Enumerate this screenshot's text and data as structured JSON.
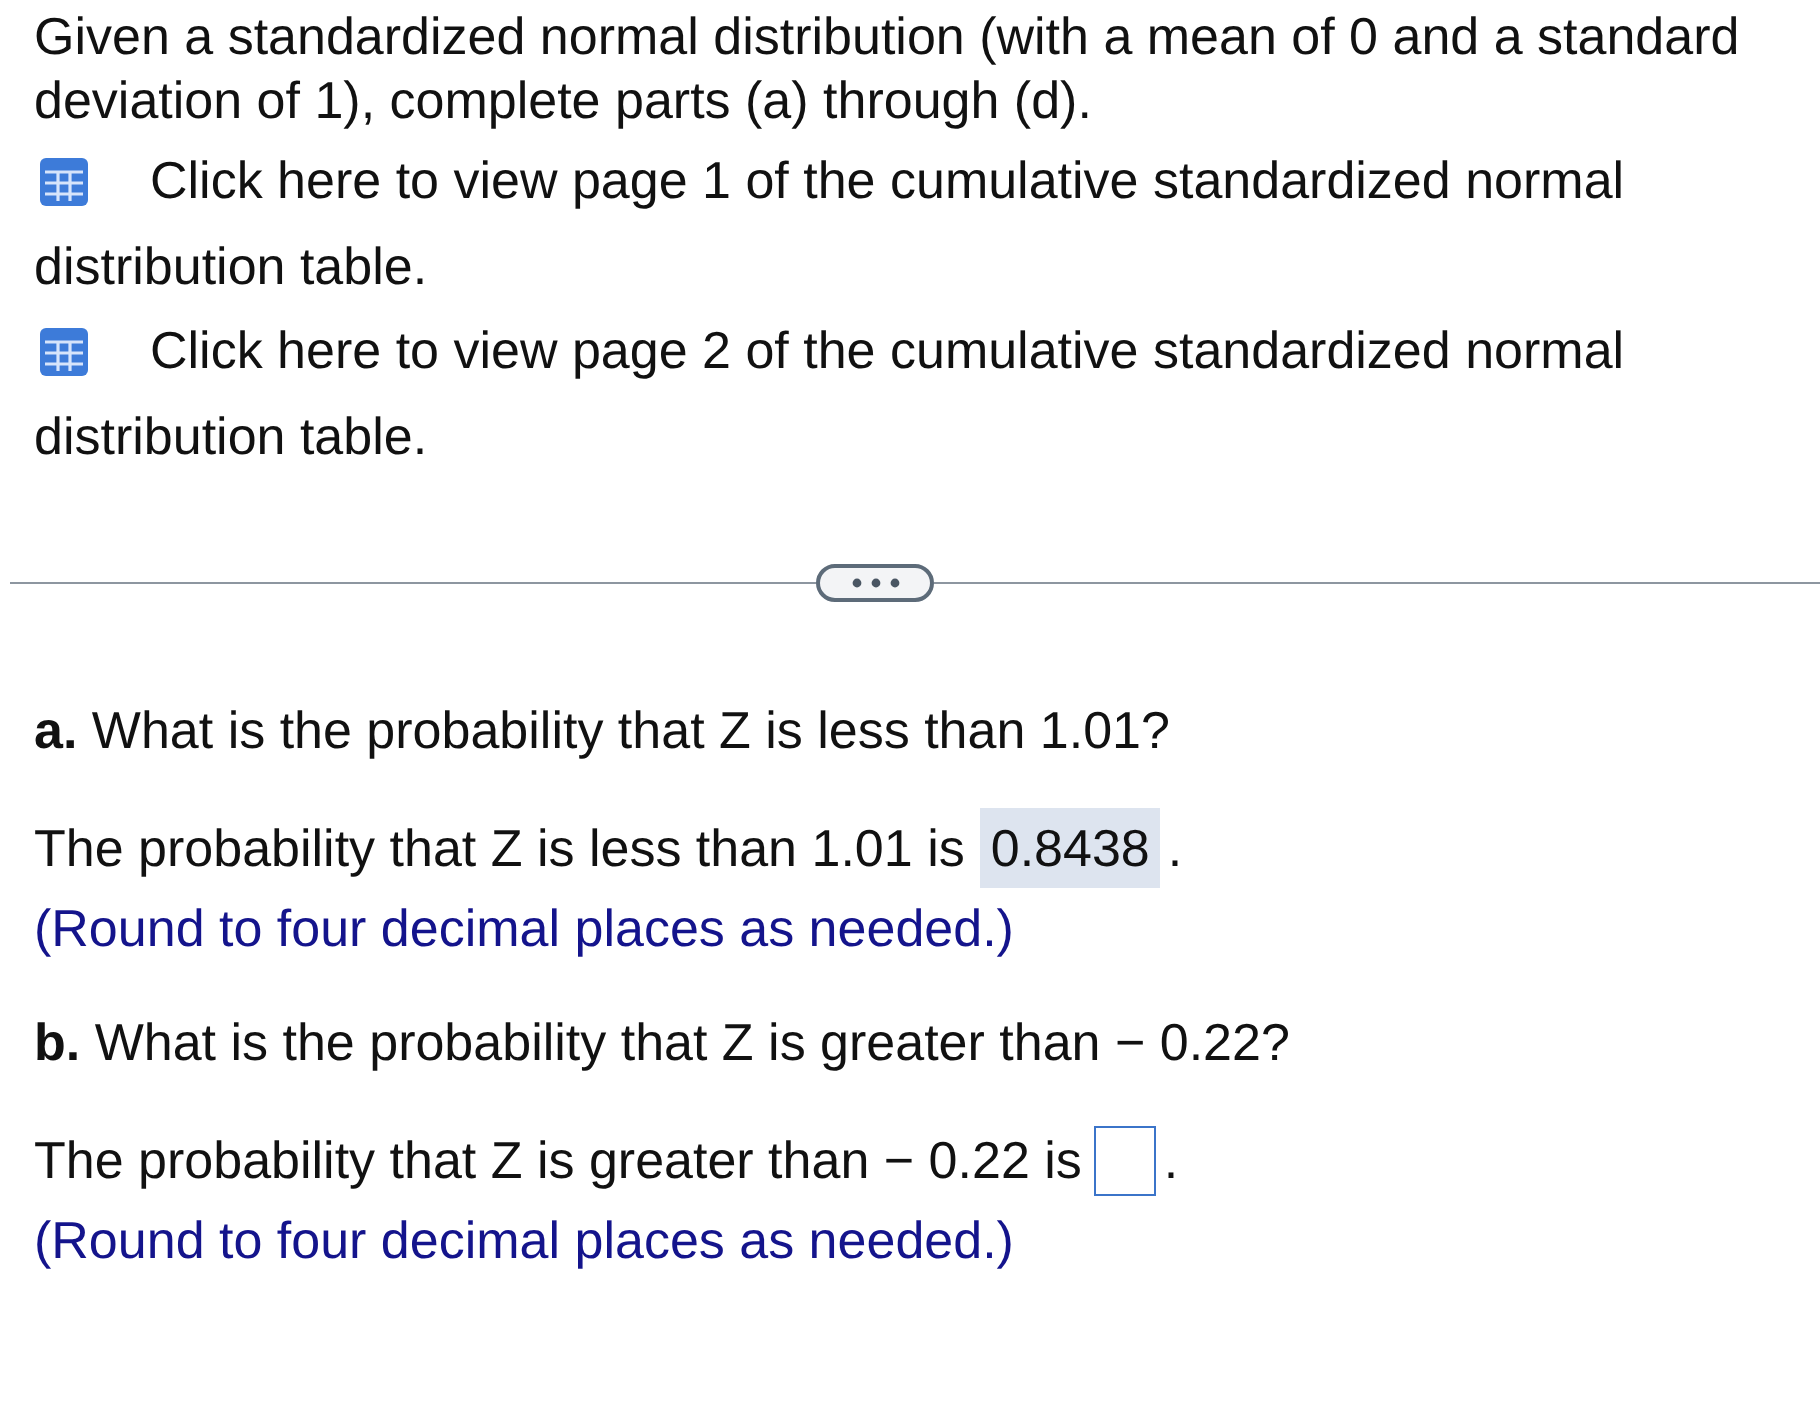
{
  "intro": {
    "text": "Given a standardized normal distribution (with a mean of 0 and a standard deviation of 1), complete parts (a) through (d)."
  },
  "table_links": [
    {
      "label": "Click here to view page 1 of the cumulative standardized normal distribution table."
    },
    {
      "label": "Click here to view page 2 of the cumulative standardized normal distribution table."
    }
  ],
  "parts": [
    {
      "question": "**a.** What is the probability that Z is less than 1.01?",
      "answer_prompt": "The probability that Z is less than 1.01 is",
      "answer": {
        "kind": "filled",
        "value": "0.8438"
      },
      "answer_end": ".",
      "hint": "(Round to four decimal places as needed.)"
    },
    {
      "question": "**b.** What is the probability that Z is greater than − 0.22?",
      "answer_prompt": "The probability that Z is greater than − 0.22 is",
      "answer": {
        "kind": "empty"
      },
      "answer_end": ".",
      "hint": "(Round to four decimal places as needed.)"
    }
  ]
}
